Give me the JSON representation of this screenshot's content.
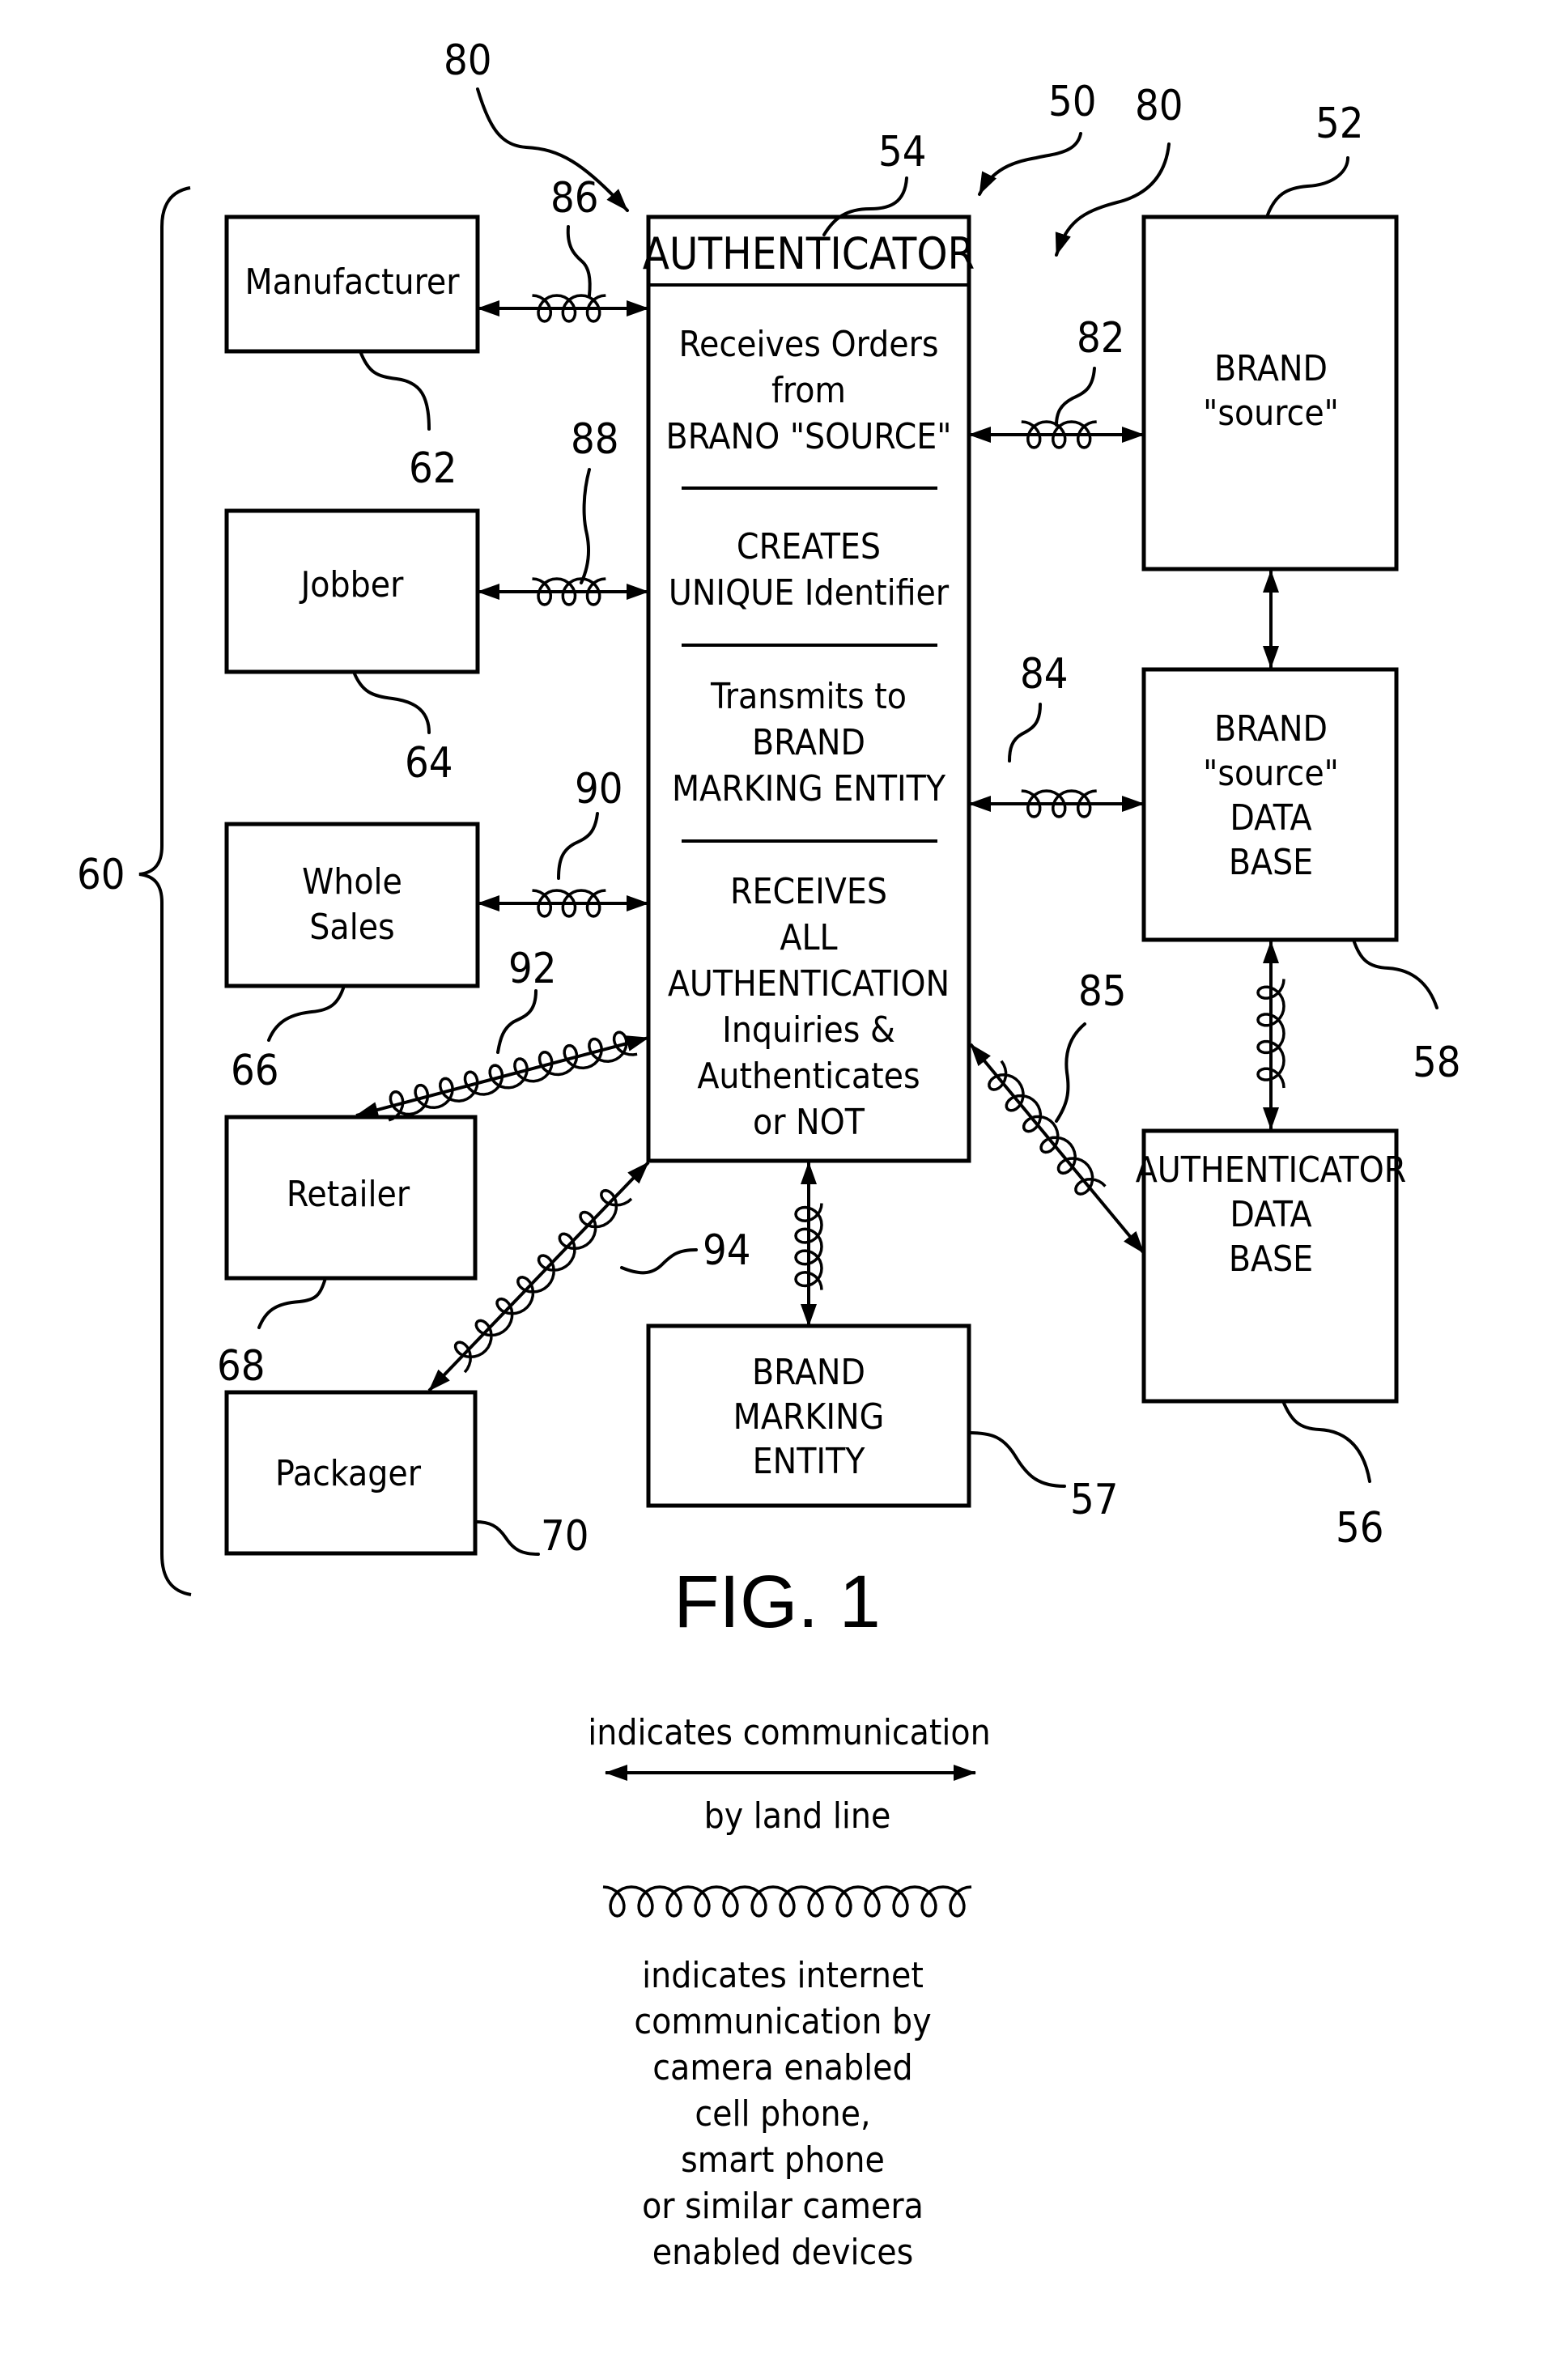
{
  "figure": {
    "caption": "FIG. 1",
    "system_ref": "50",
    "group_ref": "60",
    "arrow_refs": [
      "80",
      "80"
    ]
  },
  "authenticator": {
    "ref": "54",
    "title": "AUTHENTICATOR",
    "sections": [
      {
        "lines": [
          "Receives Orders",
          "from",
          "BRANO \"SOURCE\""
        ]
      },
      {
        "lines": [
          "CREATES",
          "UNIQUE Identifier"
        ]
      },
      {
        "lines": [
          "Transmits to",
          "BRAND",
          "MARKING ENTITY"
        ]
      },
      {
        "lines": [
          "RECEIVES",
          "ALL",
          "AUTHENTICATION",
          "Inquiries &",
          "Authenticates",
          "or NOT"
        ]
      }
    ]
  },
  "left_entities": [
    {
      "id": "manufacturer",
      "ref": "62",
      "lines": [
        "Manufacturer"
      ],
      "link_ref": "86",
      "link_type": "land-line+internet"
    },
    {
      "id": "jobber",
      "ref": "64",
      "lines": [
        "Jobber"
      ],
      "link_ref": "88",
      "link_type": "land-line+internet"
    },
    {
      "id": "whole-sales",
      "ref": "66",
      "lines": [
        "Whole",
        "Sales"
      ],
      "link_ref": "90",
      "link_type": "land-line+internet"
    },
    {
      "id": "retailer",
      "ref": "68",
      "lines": [
        "Retailer"
      ],
      "link_ref": "92",
      "link_type": "internet"
    },
    {
      "id": "packager",
      "ref": "70",
      "lines": [
        "Packager"
      ],
      "link_ref": "94",
      "link_type": "internet"
    }
  ],
  "right_entities": [
    {
      "id": "brand-source",
      "ref": "52",
      "lines": [
        "BRAND",
        "\"source\""
      ],
      "link_ref": "82"
    },
    {
      "id": "brand-source-database",
      "ref": "58",
      "lines": [
        "BRAND",
        "\"source\"",
        "DATA",
        "BASE"
      ],
      "link_ref": "84"
    },
    {
      "id": "authenticator-database",
      "ref": "56",
      "lines": [
        "AUTHENTICATOR",
        "DATA",
        "BASE"
      ],
      "link_ref": "85"
    }
  ],
  "bottom_entity": {
    "id": "brand-marking-entity",
    "ref": "57",
    "lines": [
      "BRAND",
      "MARKING",
      "ENTITY"
    ]
  },
  "legend": {
    "land_line": {
      "above": "indicates communication",
      "below": "by land line"
    },
    "internet": {
      "lines": [
        "indicates internet",
        "communication by",
        "camera enabled",
        "cell phone,",
        "smart phone",
        "or similar camera",
        "enabled devices"
      ]
    }
  }
}
